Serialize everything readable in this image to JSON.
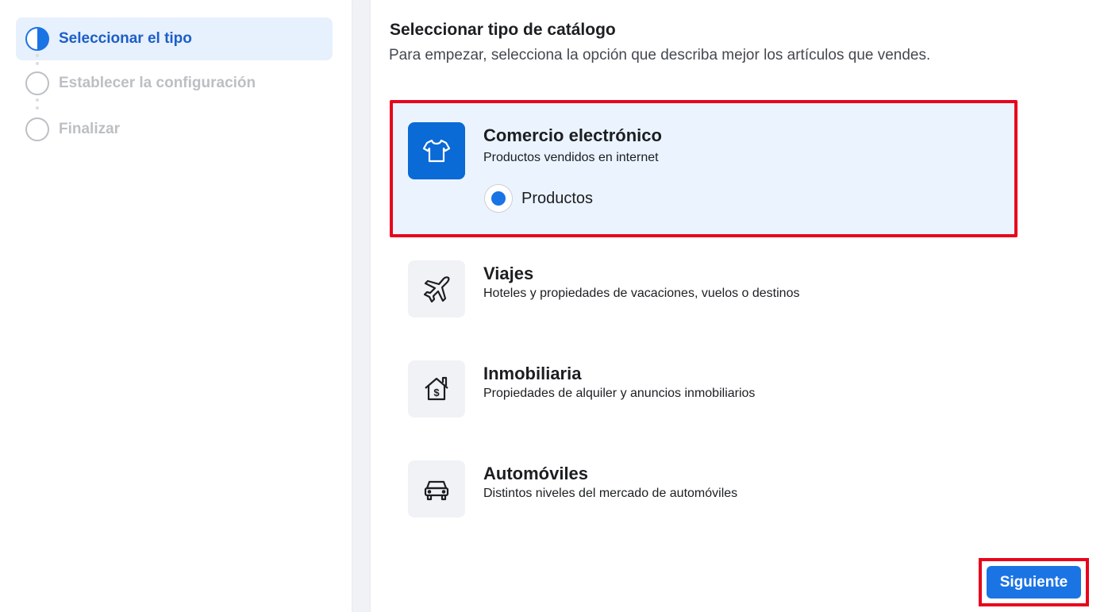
{
  "sidebar": {
    "steps": [
      {
        "label": "Seleccionar el tipo",
        "state": "active"
      },
      {
        "label": "Establecer la configuración",
        "state": "pending"
      },
      {
        "label": "Finalizar",
        "state": "pending"
      }
    ]
  },
  "main": {
    "title": "Seleccionar tipo de catálogo",
    "subtitle": "Para empezar, selecciona la opción que describa mejor los artículos que vendes.",
    "options": [
      {
        "title": "Comercio electrónico",
        "description": "Productos vendidos en internet",
        "icon": "tshirt-icon",
        "selected": true,
        "radio_label": "Productos"
      },
      {
        "title": "Viajes",
        "description": "Hoteles y propiedades de vacaciones, vuelos o destinos",
        "icon": "airplane-icon",
        "selected": false
      },
      {
        "title": "Inmobiliaria",
        "description": "Propiedades de alquiler y anuncios inmobiliarios",
        "icon": "house-dollar-icon",
        "selected": false
      },
      {
        "title": "Automóviles",
        "description": "Distintos niveles del mercado de automóviles",
        "icon": "car-icon",
        "selected": false
      }
    ],
    "next_label": "Siguiente"
  },
  "colors": {
    "accent": "#1b74e4",
    "highlight_border": "#e8051c",
    "selected_bg": "#ebf4fe"
  }
}
